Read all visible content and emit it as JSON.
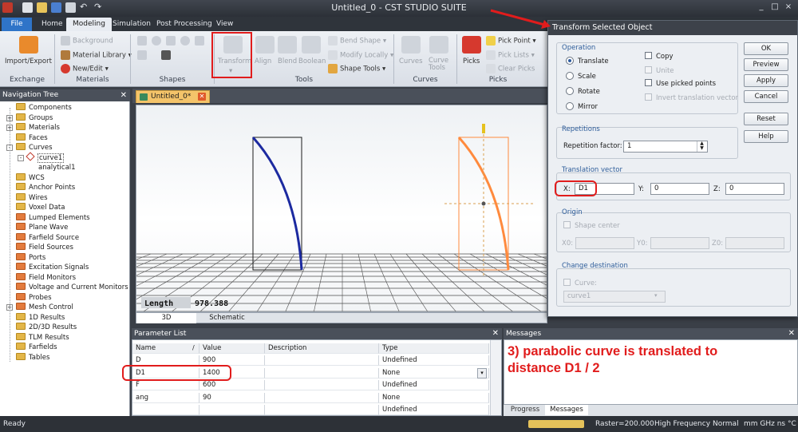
{
  "window": {
    "title": "Untitled_0 - CST STUDIO SUITE",
    "app_icon": "cst-logo-icon",
    "controls": [
      "_",
      "□",
      "×"
    ]
  },
  "ribbon_tabs": [
    "File",
    "Home",
    "Modeling",
    "Simulation",
    "Post Processing",
    "View"
  ],
  "ribbon": {
    "exchange": {
      "label": "Exchange",
      "import_export": "Import/Export"
    },
    "materials": {
      "label": "Materials",
      "background": "Background",
      "material_library": "Material Library ▾",
      "new_edit": "New/Edit ▾"
    },
    "shapes": {
      "label": "Shapes"
    },
    "tools": {
      "label": "Tools",
      "transform": "Transform",
      "align": "Align",
      "blend": "Blend",
      "boolean": "Boolean",
      "bend_shape": "Bend Shape ▾",
      "modify_locally": "Modify Locally ▾",
      "shape_tools": "Shape Tools ▾"
    },
    "curves": {
      "label": "Curves",
      "curves": "Curves",
      "curve_tools": "Curve Tools"
    },
    "picks": {
      "label": "Picks",
      "picks": "Picks",
      "pick_point": "Pick Point ▾",
      "pick_lists": "Pick Lists ▾",
      "clear_picks": "Clear Picks"
    }
  },
  "nav_tree": {
    "title": "Navigation Tree",
    "items": [
      {
        "label": "Components",
        "color": "yellow",
        "indent": 0,
        "expander": ""
      },
      {
        "label": "Groups",
        "color": "yellow",
        "indent": 0,
        "expander": "+"
      },
      {
        "label": "Materials",
        "color": "yellow",
        "indent": 0,
        "expander": "+"
      },
      {
        "label": "Faces",
        "color": "yellow",
        "indent": 0,
        "expander": ""
      },
      {
        "label": "Curves",
        "color": "yellow",
        "indent": 0,
        "expander": "-"
      },
      {
        "label": "curve1",
        "color": "curve",
        "indent": 1,
        "expander": "-"
      },
      {
        "label": "analytical1",
        "color": "none",
        "indent": 2,
        "expander": ""
      },
      {
        "label": "WCS",
        "color": "yellow",
        "indent": 0,
        "expander": ""
      },
      {
        "label": "Anchor Points",
        "color": "yellow",
        "indent": 0,
        "expander": ""
      },
      {
        "label": "Wires",
        "color": "yellow",
        "indent": 0,
        "expander": ""
      },
      {
        "label": "Voxel Data",
        "color": "yellow",
        "indent": 0,
        "expander": ""
      },
      {
        "label": "Lumped Elements",
        "color": "red",
        "indent": 0,
        "expander": ""
      },
      {
        "label": "Plane Wave",
        "color": "red",
        "indent": 0,
        "expander": ""
      },
      {
        "label": "Farfield Source",
        "color": "red",
        "indent": 0,
        "expander": ""
      },
      {
        "label": "Field Sources",
        "color": "red",
        "indent": 0,
        "expander": ""
      },
      {
        "label": "Ports",
        "color": "red",
        "indent": 0,
        "expander": ""
      },
      {
        "label": "Excitation Signals",
        "color": "red",
        "indent": 0,
        "expander": ""
      },
      {
        "label": "Field Monitors",
        "color": "red",
        "indent": 0,
        "expander": ""
      },
      {
        "label": "Voltage and Current Monitors",
        "color": "red",
        "indent": 0,
        "expander": ""
      },
      {
        "label": "Probes",
        "color": "red",
        "indent": 0,
        "expander": ""
      },
      {
        "label": "Mesh Control",
        "color": "red",
        "indent": 0,
        "expander": "+"
      },
      {
        "label": "1D Results",
        "color": "yellow",
        "indent": 0,
        "expander": ""
      },
      {
        "label": "2D/3D Results",
        "color": "yellow",
        "indent": 0,
        "expander": ""
      },
      {
        "label": "TLM Results",
        "color": "yellow",
        "indent": 0,
        "expander": ""
      },
      {
        "label": "Farfields",
        "color": "yellow",
        "indent": 0,
        "expander": ""
      },
      {
        "label": "Tables",
        "color": "yellow",
        "indent": 0,
        "expander": ""
      }
    ]
  },
  "document_tab": "Untitled_0*",
  "viewport": {
    "length_label": "Length",
    "length_value": "978.388",
    "tabs": [
      "3D",
      "Schematic"
    ]
  },
  "parameter_list": {
    "title": "Parameter List",
    "columns": [
      "Name",
      "Value",
      "Description",
      "Type"
    ],
    "sort_marker": "/",
    "rows": [
      {
        "name": "D",
        "value": "900",
        "description": "",
        "type": "Undefined"
      },
      {
        "name": "D1",
        "value": "1400",
        "description": "",
        "type": "None"
      },
      {
        "name": "F",
        "value": "600",
        "description": "",
        "type": "Undefined"
      },
      {
        "name": "ang",
        "value": "90",
        "description": "",
        "type": "None"
      },
      {
        "name": "",
        "value": "",
        "description": "",
        "type": "Undefined"
      }
    ]
  },
  "messages": {
    "title": "Messages",
    "annotation": "3) parabolic curve is translated to distance D1 / 2",
    "tabs": [
      "Progress",
      "Messages"
    ]
  },
  "status_bar": {
    "ready": "Ready",
    "raster": "Raster=200.000",
    "frequency": "High Frequency",
    "mode": "Normal",
    "units": "mm  GHz  ns  °C"
  },
  "dialog": {
    "title": "Transform Selected Object",
    "operation": {
      "label": "Operation",
      "options": [
        "Translate",
        "Scale",
        "Rotate",
        "Mirror"
      ],
      "selected": "Translate"
    },
    "checks": {
      "copy": "Copy",
      "unite": "Unite",
      "use_picked_points": "Use picked points",
      "invert_translation_vector": "Invert translation vector"
    },
    "buttons": {
      "ok": "OK",
      "preview": "Preview",
      "apply": "Apply",
      "cancel": "Cancel",
      "reset": "Reset",
      "help": "Help"
    },
    "repetitions": {
      "label": "Repetitions",
      "factor_label": "Repetition factor:",
      "factor_value": "1"
    },
    "translation_vector": {
      "label": "Translation vector",
      "x_label": "X:",
      "x_value": "D1",
      "y_label": "Y:",
      "y_value": "0",
      "z_label": "Z:",
      "z_value": "0"
    },
    "origin": {
      "label": "Origin",
      "shape_center": "Shape center",
      "x0": "X0:",
      "y0": "Y0:",
      "z0": "Z0:"
    },
    "change_destination": {
      "label": "Change destination",
      "curve_label": "Curve:",
      "curve_value": "curve1"
    }
  },
  "colors": {
    "annotation_red": "#e11c1c",
    "curve_blue": "#1c2aa0",
    "curve_orange": "#ff8a3d"
  }
}
